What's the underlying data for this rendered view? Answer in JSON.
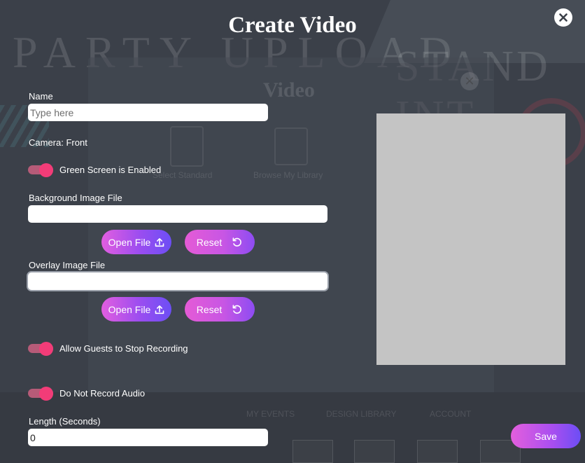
{
  "modal": {
    "title": "Create Video",
    "close_icon": "close-icon"
  },
  "name": {
    "label": "Name",
    "value": "",
    "placeholder": "Type here"
  },
  "camera": {
    "label": "Camera: Front"
  },
  "green_screen": {
    "label": "Green Screen is Enabled",
    "enabled": true
  },
  "background_image": {
    "label": "Background Image File",
    "value": "",
    "open_label": "Open File",
    "reset_label": "Reset"
  },
  "overlay_image": {
    "label": "Overlay Image File",
    "value": "",
    "open_label": "Open File",
    "reset_label": "Reset"
  },
  "allow_guests_stop": {
    "label": "Allow Guests to Stop Recording",
    "enabled": true
  },
  "no_audio": {
    "label": "Do Not Record Audio",
    "enabled": true
  },
  "length": {
    "label": "Length (Seconds)",
    "value": "0"
  },
  "save_label": "Save",
  "background_app": {
    "banner_left": "PARTY UPLOAD",
    "banner_right": "STAND INT",
    "dialog_title": "Video",
    "option_standard": "Select Standard",
    "option_library": "Browse My Library",
    "nav_events": "MY EVENTS",
    "nav_design": "DESIGN LIBRARY",
    "nav_account": "ACCOUNT"
  },
  "colors": {
    "overlay_bg": "#3b4049",
    "toggle_knob": "#f23c78",
    "toggle_track": "#b65b78",
    "gradient_start": "#e25ee0",
    "gradient_end": "#6c4ef5",
    "preview": "#c4c4c4"
  }
}
